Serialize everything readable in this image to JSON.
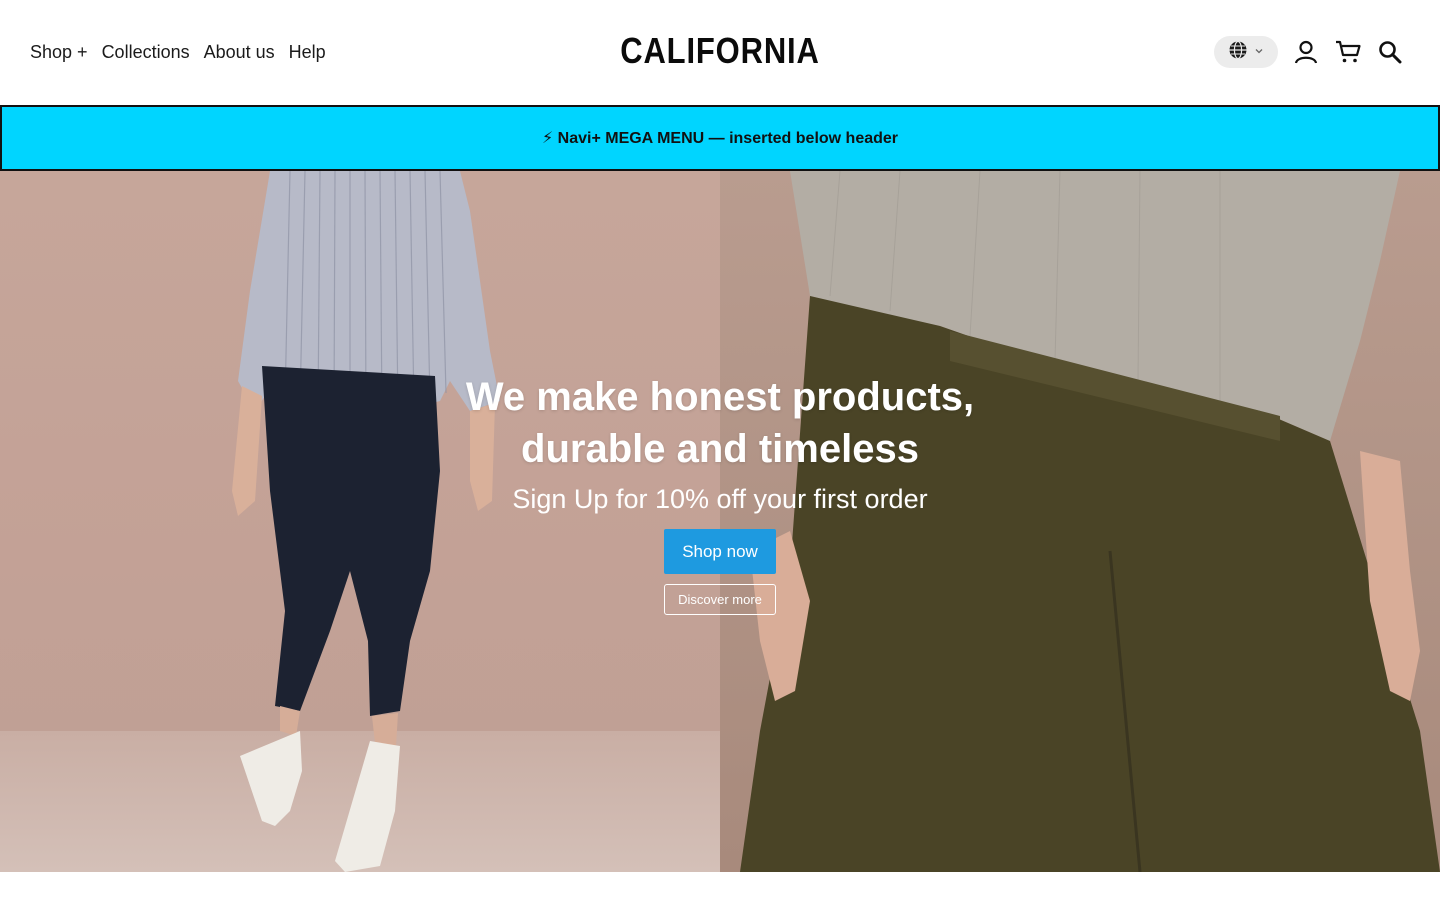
{
  "header": {
    "nav": [
      "Shop +",
      "Collections",
      "About us",
      "Help"
    ],
    "logo": "CALIFORNIA",
    "icons": [
      "globe-icon",
      "chevron-down-icon",
      "account-icon",
      "cart-icon",
      "search-icon"
    ]
  },
  "banner": {
    "text": "⚡ Navi+ MEGA MENU — inserted below header",
    "color": "#00d5ff"
  },
  "hero": {
    "headline_line1": "We make honest products,",
    "headline_line2": "durable and timeless",
    "subheadline": "Sign Up for 10% off your first order",
    "primary_button": "Shop now",
    "secondary_button": "Discover more",
    "accent_color": "#1e9ae0"
  }
}
